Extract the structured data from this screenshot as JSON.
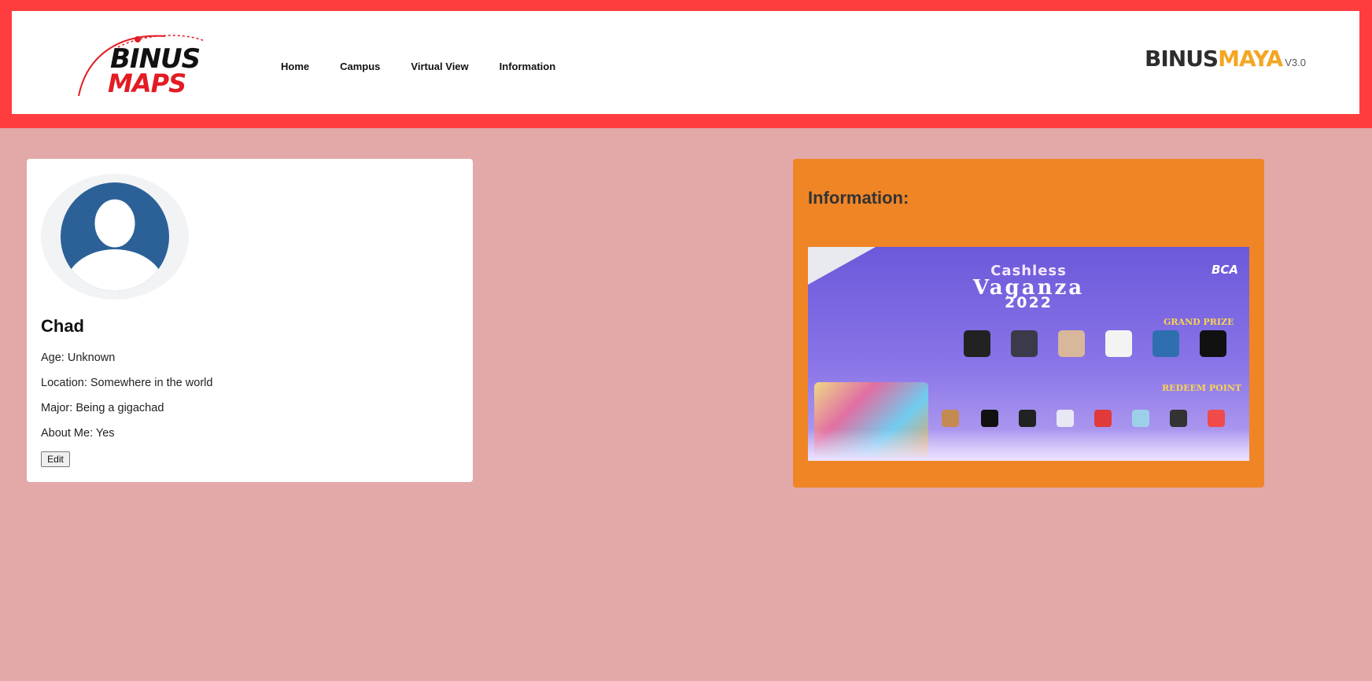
{
  "header": {
    "logo_left": {
      "line1": "BINUS",
      "line2": "MAPS"
    },
    "nav": [
      "Home",
      "Campus",
      "Virtual View",
      "Information"
    ],
    "logo_right": {
      "part1": "BINUS",
      "part2": "MAYA",
      "version": "V3.0"
    }
  },
  "profile": {
    "name": "Chad",
    "age": "Age: Unknown",
    "location": "Location: Somewhere in the world",
    "major": "Major: Being a gigachad",
    "about": "About Me: Yes",
    "edit_label": "Edit"
  },
  "info": {
    "title": "Information:",
    "banner": {
      "line1": "Cashless",
      "line2": "Vaganza",
      "line3": "2022",
      "brand": "BCA",
      "grand_prize": "GRAND PRIZE",
      "redeem_point": "REDEEM POINT"
    }
  },
  "colors": {
    "header_frame": "#ff3d3f",
    "page_bg": "#e3a9a9",
    "info_card": "#f08526",
    "avatar": "#2b6197"
  }
}
